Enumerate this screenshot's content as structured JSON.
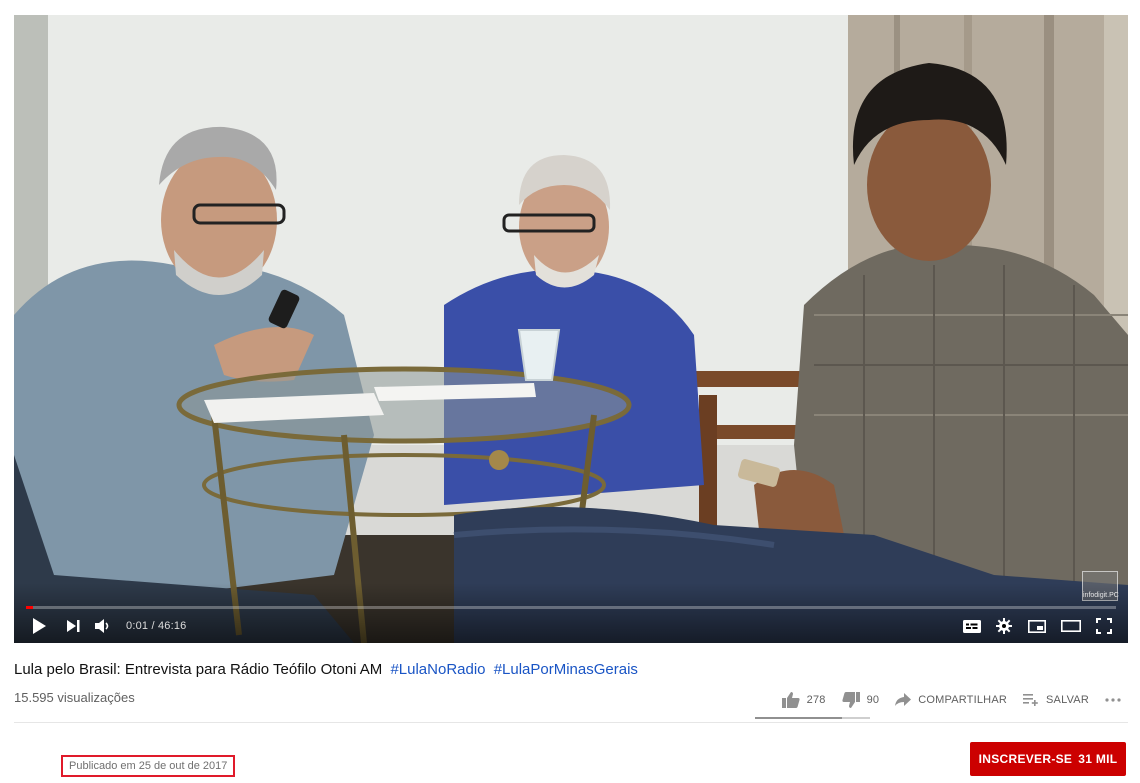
{
  "player": {
    "time_current": "0:01",
    "time_total": "46:16",
    "time_display": "0:01 / 46:16",
    "progress_fraction": 0.0004,
    "watermark": "infodigit.PC"
  },
  "video": {
    "title": "Lula pelo Brasil: Entrevista para Rádio Teófilo Otoni AM",
    "hashtags": [
      "#LulaNoRadio",
      "#LulaPorMinasGerais"
    ],
    "views": "15.595 visualizações"
  },
  "actions": {
    "likes": "278",
    "dislikes": "90",
    "share_label": "COMPARTILHAR",
    "save_label": "SALVAR",
    "like_fraction": 0.755
  },
  "channel": {
    "published": "Publicado em 25 de out de 2017",
    "subscribe_label": "INSCREVER-SE",
    "subscriber_count": "31 MIL"
  },
  "colors": {
    "accent": "#cc0000",
    "progress": "#ff0000",
    "link": "#1a55c5",
    "highlight_box": "#e01a2a"
  }
}
